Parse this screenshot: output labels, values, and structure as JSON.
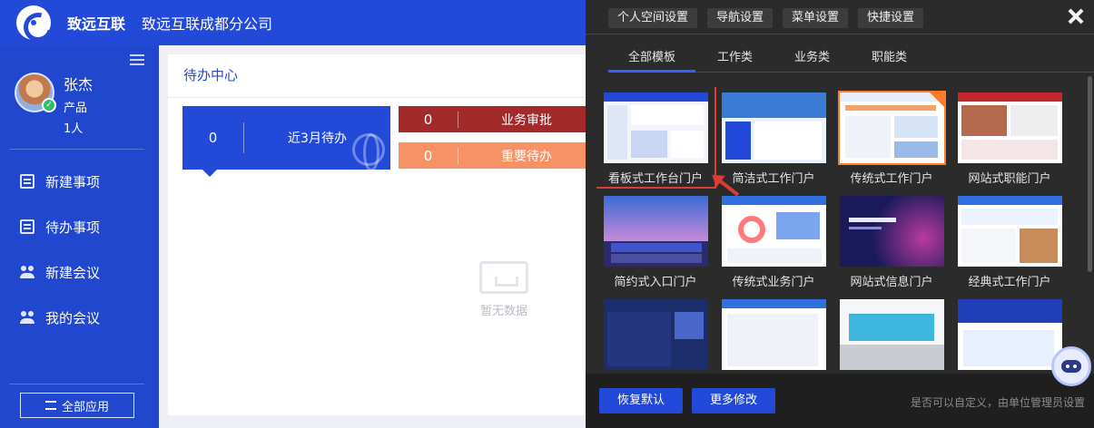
{
  "header": {
    "brand": "致远互联",
    "company": "致远互联成都分公司"
  },
  "user": {
    "name": "张杰",
    "role": "产品",
    "count": "1人"
  },
  "sidebar": {
    "items": [
      {
        "label": "新建事项",
        "icon": "new-item-icon"
      },
      {
        "label": "待办事项",
        "icon": "todo-icon"
      },
      {
        "label": "新建会议",
        "icon": "new-meeting-icon"
      },
      {
        "label": "我的会议",
        "icon": "my-meeting-icon"
      }
    ],
    "all_apps": "全部应用"
  },
  "main": {
    "title": "待办中心",
    "cards": [
      {
        "count": "0",
        "label": "近3月待办"
      },
      {
        "count": "0",
        "label": "业务审批"
      },
      {
        "count": "0",
        "label": "重要待办"
      }
    ],
    "empty_text": "暂无数据"
  },
  "panel": {
    "tabs": [
      "个人空间设置",
      "导航设置",
      "菜单设置",
      "快捷设置"
    ],
    "categories": [
      "全部模板",
      "工作类",
      "业务类",
      "职能类"
    ],
    "templates": [
      "看板式工作台门户",
      "简洁式工作门户",
      "传统式工作门户",
      "网站式职能门户",
      "简约式入口门户",
      "传统式业务门户",
      "网站式信息门户",
      "经典式工作门户"
    ],
    "footer": {
      "reset": "恢复默认",
      "more": "更多修改",
      "note": "是否可以自定义，由单位管理员设置"
    }
  },
  "colors": {
    "primary": "#2349d8",
    "panel": "#2b2b2b",
    "red": "#a32a2b",
    "orange": "#f79166"
  }
}
